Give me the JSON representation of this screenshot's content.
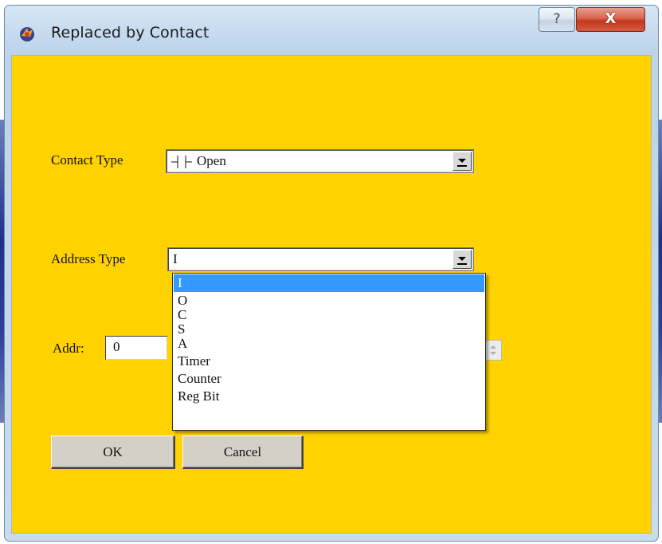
{
  "window": {
    "title": "Replaced by Contact",
    "help_glyph": "?",
    "close_glyph": "X",
    "icon": "app-logo-icon"
  },
  "form": {
    "contact_type_label": "Contact Type",
    "contact_type_value": "Open",
    "contact_type_icon": "contact-open-icon",
    "address_type_label": "Address Type",
    "address_type_value": "I",
    "addr_label": "Addr:",
    "addr_value": "0"
  },
  "address_options": [
    {
      "label": "I",
      "selected": true
    },
    {
      "label": "O",
      "selected": false
    },
    {
      "label": "C",
      "selected": false
    },
    {
      "label": "S",
      "selected": false
    },
    {
      "label": "A",
      "selected": false
    },
    {
      "label": "Timer",
      "selected": false
    },
    {
      "label": "Counter",
      "selected": false
    },
    {
      "label": "Reg Bit",
      "selected": false
    }
  ],
  "buttons": {
    "ok": "OK",
    "cancel": "Cancel"
  },
  "colors": {
    "client_background": "#ffd200",
    "selection": "#3399ff",
    "close_button": "#c2391f"
  }
}
